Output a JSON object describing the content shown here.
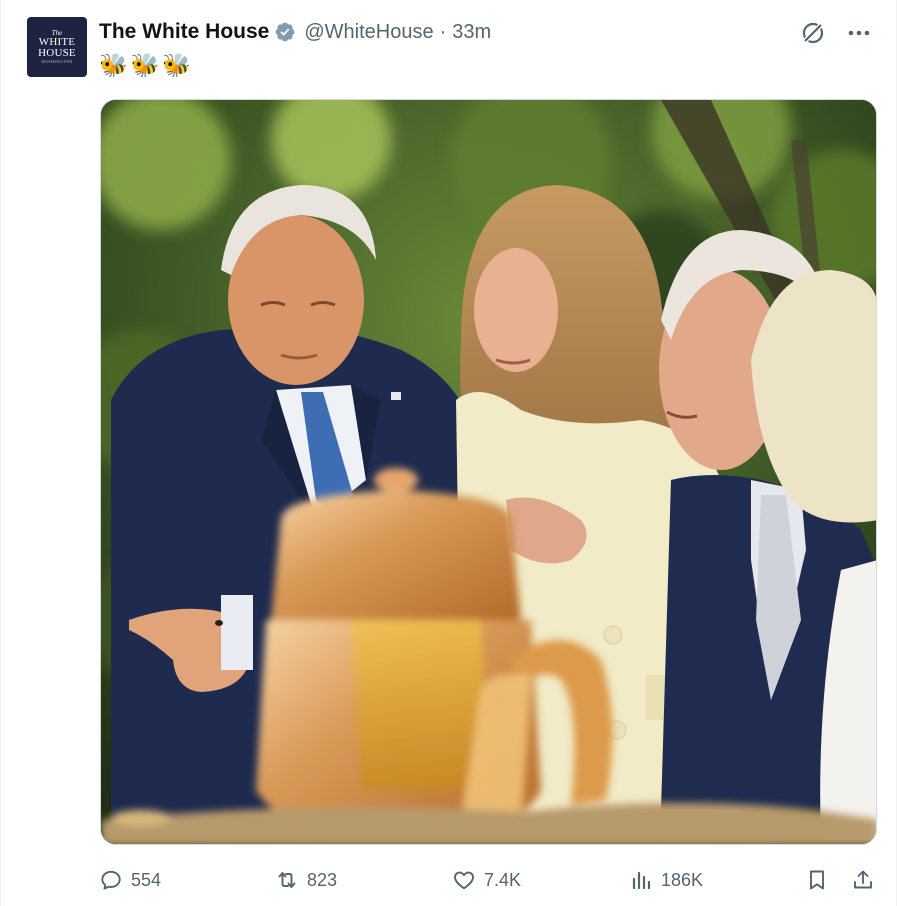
{
  "account": {
    "name": "The White House",
    "handle": "@WhiteHouse",
    "separator": "·",
    "time": "33m",
    "avatar_text": [
      "The",
      "WHITE",
      "HOUSE",
      "WASHINGTON"
    ]
  },
  "tweet": {
    "text": "🐝🐝🐝"
  },
  "icons": {
    "verified": "verified-badge-icon",
    "grok": "grok-icon",
    "more": "more-icon",
    "reply": "reply-icon",
    "retweet": "retweet-icon",
    "like": "like-icon",
    "views": "views-icon",
    "bookmark": "bookmark-icon",
    "share": "share-icon"
  },
  "stats": {
    "replies": "554",
    "retweets": "823",
    "likes": "7.4K",
    "views": "186K"
  },
  "colors": {
    "text": "#0f1419",
    "secondary": "#536471",
    "verified_gray": "#829aab",
    "border": "#cfd9de"
  }
}
